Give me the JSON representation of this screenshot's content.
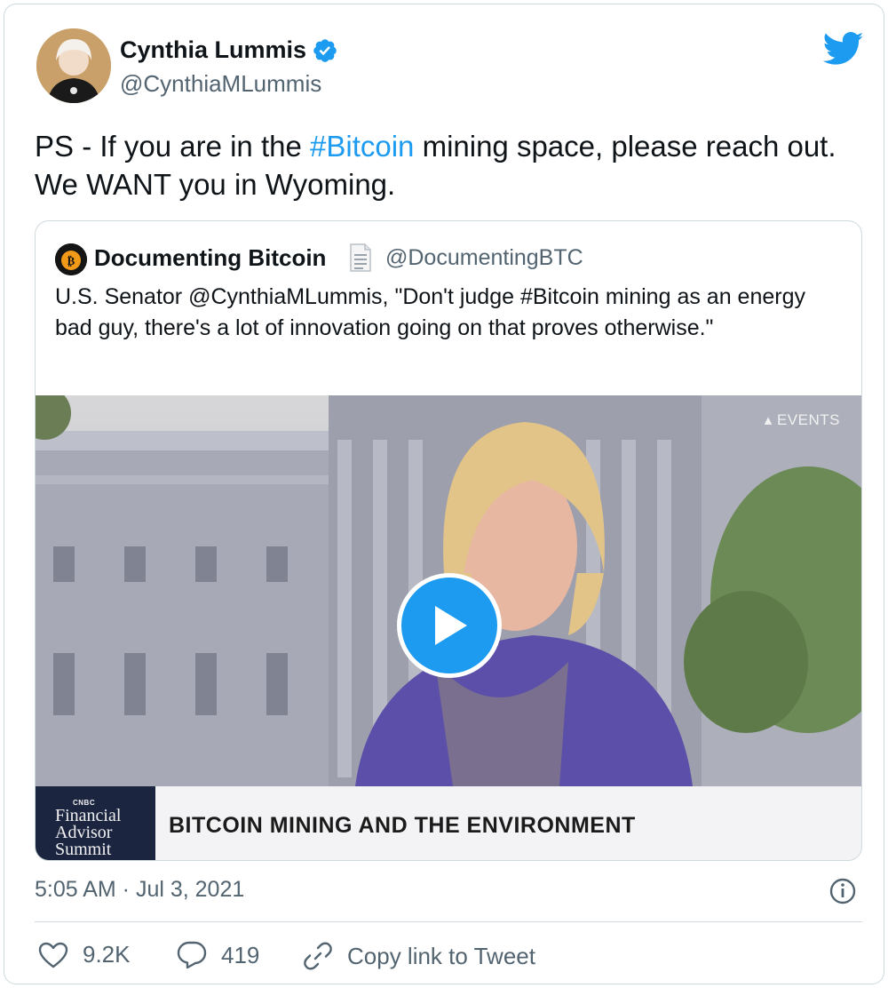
{
  "tweet": {
    "author_name": "Cynthia Lummis",
    "author_handle": "@CynthiaMLummis",
    "text_parts": [
      "PS - If you are in the ",
      "#Bitcoin",
      " mining space, please reach out. We WANT you in Wyoming."
    ],
    "timestamp": "5:05 AM · Jul 3, 2021"
  },
  "quote": {
    "author_name": "Documenting Bitcoin",
    "author_handle": "@DocumentingBTC",
    "text": "U.S. Senator @CynthiaMLummis, \"Don't judge #Bitcoin mining as an energy bad guy, there's a lot of innovation going on that proves otherwise.\"",
    "video": {
      "watermark": "EVENTS",
      "summit_brand": "CNBC",
      "summit_line1": "Financial",
      "summit_line2": "Advisor",
      "summit_line3": "Summit",
      "headline": "BITCOIN MINING AND THE ENVIRONMENT"
    }
  },
  "actions": {
    "likes": "9.2K",
    "replies": "419",
    "copy_link": "Copy link to Tweet"
  },
  "colors": {
    "accent": "#1d9bf0",
    "secondary_text": "#536471",
    "border": "#cfd9de"
  },
  "icons": [
    "verified-badge-icon",
    "twitter-bird-icon",
    "document-icon",
    "play-icon",
    "info-icon",
    "heart-icon",
    "reply-icon",
    "link-icon"
  ]
}
